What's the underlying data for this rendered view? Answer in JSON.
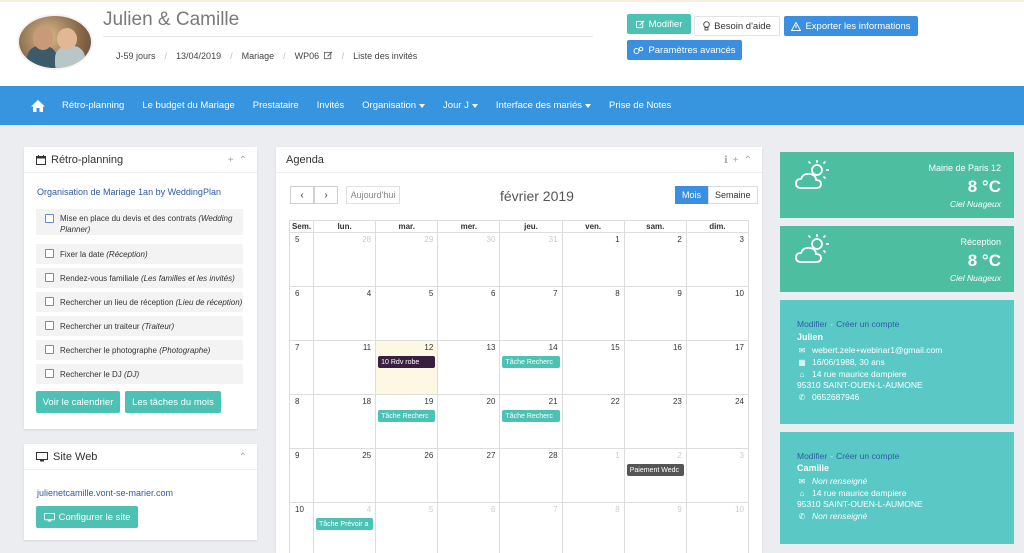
{
  "header": {
    "couple_name": "Julien & Camille",
    "breadcrumbs": [
      "J-59 jours",
      "13/04/2019",
      "Mariage",
      "WP06",
      "Liste des invités"
    ],
    "buttons": {
      "modifier": "Modifier",
      "aide": "Besoin d'aide",
      "export": "Exporter les informations",
      "params": "Paramètres avancés"
    }
  },
  "nav": {
    "items": [
      {
        "label": "Rétro-planning",
        "dropdown": false
      },
      {
        "label": "Le budget du Mariage",
        "dropdown": false
      },
      {
        "label": "Prestataire",
        "dropdown": false
      },
      {
        "label": "Invités",
        "dropdown": false
      },
      {
        "label": "Organisation",
        "dropdown": true
      },
      {
        "label": "Jour J",
        "dropdown": true
      },
      {
        "label": "Interface des mariés",
        "dropdown": true
      },
      {
        "label": "Prise de Notes",
        "dropdown": false
      }
    ]
  },
  "retro": {
    "title": "Rétro-planning",
    "link": "Organisation de Mariage 1an by WeddingPlan",
    "tasks": [
      {
        "text": "Mise en place du devis et des contrats",
        "tag": "(Wedding Planner)"
      },
      {
        "text": "Fixer la date",
        "tag": "(Réception)"
      },
      {
        "text": "Rendez-vous familiale",
        "tag": "(Les familles et les invités)"
      },
      {
        "text": "Rechercher un lieu de réception",
        "tag": "(Lieu de réception)"
      },
      {
        "text": "Rechercher un traiteur",
        "tag": "(Traiteur)"
      },
      {
        "text": "Rechercher le photographe",
        "tag": "(Photographe)"
      },
      {
        "text": "Rechercher le DJ",
        "tag": "(DJ)"
      }
    ],
    "btn_calendar": "Voir le calendrier",
    "btn_month": "Les tâches du mois"
  },
  "site": {
    "title": "Site Web",
    "url": "julienetcamille.vont-se-marier.com",
    "btn": "Configurer le site"
  },
  "agenda": {
    "title": "Agenda",
    "today": "Aujourd'hui",
    "month": "février 2019",
    "view_month": "Mois",
    "view_week": "Semaine",
    "headers": [
      "Sem.",
      "lun.",
      "mar.",
      "mer.",
      "jeu.",
      "ven.",
      "sam.",
      "dim."
    ],
    "weeks": [
      {
        "sem": "5",
        "days": [
          {
            "n": "28",
            "o": true
          },
          {
            "n": "29",
            "o": true
          },
          {
            "n": "30",
            "o": true
          },
          {
            "n": "31",
            "o": true
          },
          {
            "n": "1"
          },
          {
            "n": "2"
          },
          {
            "n": "3"
          }
        ]
      },
      {
        "sem": "6",
        "days": [
          {
            "n": "4"
          },
          {
            "n": "5"
          },
          {
            "n": "6"
          },
          {
            "n": "7"
          },
          {
            "n": "8"
          },
          {
            "n": "9"
          },
          {
            "n": "10"
          }
        ]
      },
      {
        "sem": "7",
        "days": [
          {
            "n": "11"
          },
          {
            "n": "12",
            "today": true,
            "ev": {
              "t": "10 Rdv robe",
              "c": "dark"
            }
          },
          {
            "n": "13"
          },
          {
            "n": "14",
            "ev": {
              "t": "Tâche Recherc",
              "c": "green"
            }
          },
          {
            "n": "15"
          },
          {
            "n": "16"
          },
          {
            "n": "17"
          }
        ]
      },
      {
        "sem": "8",
        "days": [
          {
            "n": "18"
          },
          {
            "n": "19",
            "ev": {
              "t": "Tâche Recherc",
              "c": "green"
            }
          },
          {
            "n": "20"
          },
          {
            "n": "21",
            "ev": {
              "t": "Tâche Recherc",
              "c": "green"
            }
          },
          {
            "n": "22"
          },
          {
            "n": "23"
          },
          {
            "n": "24"
          }
        ]
      },
      {
        "sem": "9",
        "days": [
          {
            "n": "25"
          },
          {
            "n": "26"
          },
          {
            "n": "27"
          },
          {
            "n": "28"
          },
          {
            "n": "1",
            "o": true
          },
          {
            "n": "2",
            "o": true,
            "ev": {
              "t": "Paiement Wedc",
              "c": "gray"
            }
          },
          {
            "n": "3",
            "o": true
          }
        ]
      },
      {
        "sem": "10",
        "days": [
          {
            "n": "4",
            "o": true,
            "ev": {
              "t": "Tâche Prévoir a",
              "c": "green"
            }
          },
          {
            "n": "5",
            "o": true
          },
          {
            "n": "6",
            "o": true
          },
          {
            "n": "7",
            "o": true
          },
          {
            "n": "8",
            "o": true
          },
          {
            "n": "9",
            "o": true
          },
          {
            "n": "10",
            "o": true
          }
        ]
      }
    ]
  },
  "weather": [
    {
      "location": "Mairie de Paris 12",
      "temp": "8 °C",
      "desc": "Ciel Nuageux"
    },
    {
      "location": "Réception",
      "temp": "8 °C",
      "desc": "Ciel Nuageux"
    }
  ],
  "contacts": [
    {
      "modifier": "Modifier",
      "create": "Créer un compte",
      "name": "Julien",
      "email": "webert.zele+webinar1@gmail.com",
      "birth": "16/06/1988, 30 ans",
      "address": "14 rue maurice dampiere",
      "city": "95310 SAINT-OUEN-L-AUMONE",
      "phone": "0652687946"
    },
    {
      "modifier": "Modifier",
      "create": "Créer un compte",
      "name": "Camille",
      "email": "Non renseigné",
      "address": "14 rue maurice dampiere",
      "city": "95310 SAINT-OUEN-L-AUMONE",
      "phone": "Non renseigné"
    }
  ]
}
